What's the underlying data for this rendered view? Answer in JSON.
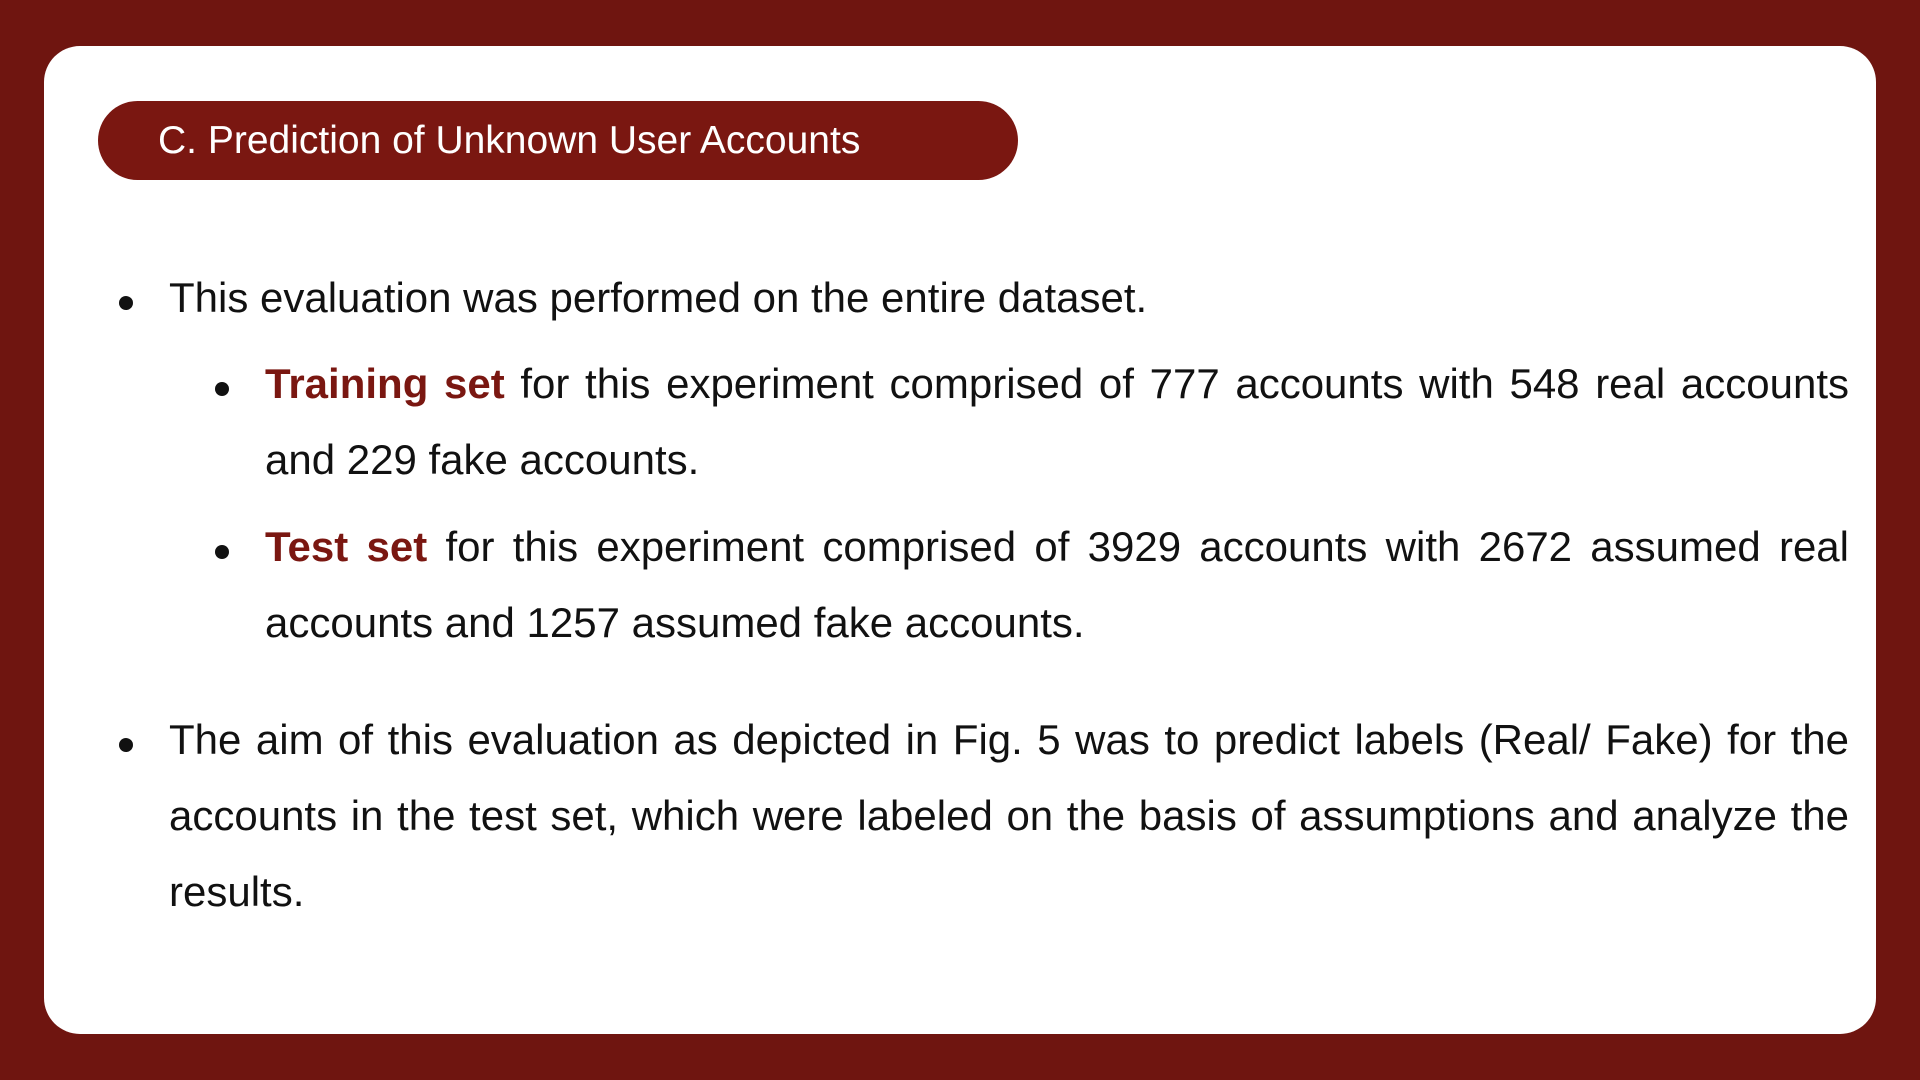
{
  "section": {
    "title": "C. Prediction of Unknown User Accounts"
  },
  "bullets": [
    {
      "text": "This evaluation was performed on the entire dataset."
    },
    {
      "highlight": "Training set",
      "text": " for this experiment comprised of 777 accounts with 548 real accounts and 229 fake accounts."
    },
    {
      "highlight": "Test set",
      "text": " for this experiment comprised of 3929 accounts with 2672 assumed real accounts and 1257 assumed fake accounts."
    },
    {
      "text": "The aim of this evaluation as depicted in Fig. 5 was to predict labels (Real/ Fake) for the accounts in the test set, which were labeled on the basis of assumptions and analyze the results."
    }
  ],
  "colors": {
    "background": "#6f1510",
    "accent": "#7a1711",
    "card": "#ffffff",
    "text": "#111111"
  }
}
